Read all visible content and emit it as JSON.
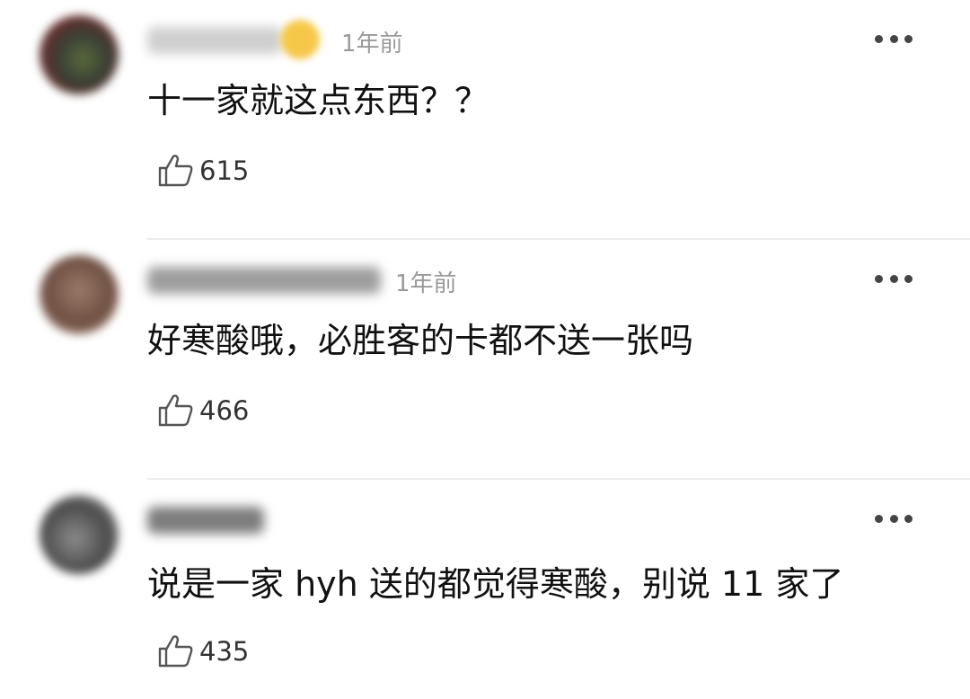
{
  "comments": [
    {
      "username": "",
      "time": "1年前",
      "text": "十一家就这点东西？？",
      "likes": "615"
    },
    {
      "username": "",
      "time": "1年前",
      "text": "好寒酸哦，必胜客的卡都不送一张吗",
      "likes": "466"
    },
    {
      "username": "",
      "time": "",
      "text": "说是一家 hyh 送的都觉得寒酸，别说 11 家了",
      "likes": "435"
    }
  ],
  "icons": {
    "like": "thumbs-up-icon",
    "more": "more-dots-icon",
    "badge": "heart-badge-icon"
  }
}
